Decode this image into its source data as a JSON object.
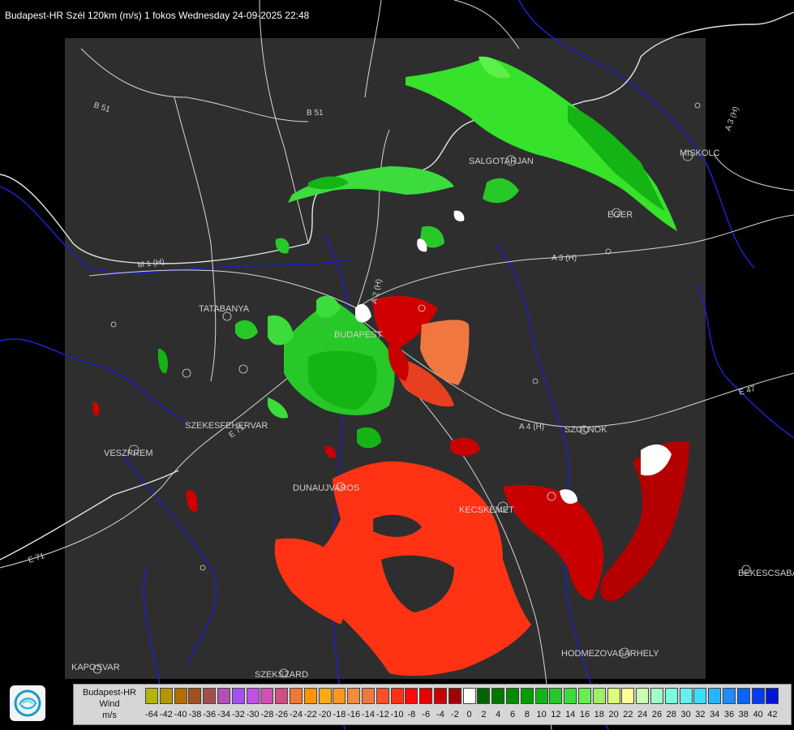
{
  "title": "Budapest-HR Szél 120km (m/s) 1 fokos Wednesday 24-09-2025 22:48",
  "map": {
    "cities": [
      {
        "name": "SALGOTARJAN"
      },
      {
        "name": "MISKOLC"
      },
      {
        "name": "EGER"
      },
      {
        "name": "TATABANYA"
      },
      {
        "name": "BUDAPEST"
      },
      {
        "name": "SZEKESFEHERVAR"
      },
      {
        "name": "VESZPREM"
      },
      {
        "name": "DUNAUJVAROS"
      },
      {
        "name": "KECSKEMET"
      },
      {
        "name": "SZOLNOK"
      },
      {
        "name": "BEKESCSABA"
      },
      {
        "name": "HODMEZOVASARHELY"
      },
      {
        "name": "KAPOSVAR"
      },
      {
        "name": "SZEKSZARD"
      }
    ],
    "roads": [
      "B 51",
      "B 51",
      "A 3 (H)",
      "A 3 (H)",
      "A 2 (H)",
      "M 1 (H)",
      "A 4 (H)",
      "E 71",
      "E 71",
      "E 47"
    ]
  },
  "legend": {
    "label_lines": [
      "Budapest-HR",
      "Wind",
      "m/s"
    ],
    "swatches": [
      {
        "value": "-64",
        "color": "#b4b40a"
      },
      {
        "value": "-42",
        "color": "#b49600"
      },
      {
        "value": "-40",
        "color": "#b46e00"
      },
      {
        "value": "-38",
        "color": "#a0501e"
      },
      {
        "value": "-36",
        "color": "#a05050"
      },
      {
        "value": "-34",
        "color": "#b450b4"
      },
      {
        "value": "-32",
        "color": "#a050f0"
      },
      {
        "value": "-30",
        "color": "#c050e6"
      },
      {
        "value": "-28",
        "color": "#d050b4"
      },
      {
        "value": "-26",
        "color": "#d24b82"
      },
      {
        "value": "-24",
        "color": "#f07832"
      },
      {
        "value": "-22",
        "color": "#ff9600"
      },
      {
        "value": "-20",
        "color": "#ffaa14"
      },
      {
        "value": "-18",
        "color": "#ff961e"
      },
      {
        "value": "-16",
        "color": "#f08c3c"
      },
      {
        "value": "-14",
        "color": "#f0783c"
      },
      {
        "value": "-12",
        "color": "#ff5028"
      },
      {
        "value": "-10",
        "color": "#ff3214"
      },
      {
        "value": "-8",
        "color": "#ff0a0a"
      },
      {
        "value": "-6",
        "color": "#e60000"
      },
      {
        "value": "-4",
        "color": "#c80000"
      },
      {
        "value": "-2",
        "color": "#a00000"
      },
      {
        "value": "0",
        "color": "#ffffff"
      },
      {
        "value": "2",
        "color": "#006400"
      },
      {
        "value": "4",
        "color": "#007800"
      },
      {
        "value": "6",
        "color": "#008c00"
      },
      {
        "value": "8",
        "color": "#00a000"
      },
      {
        "value": "10",
        "color": "#14b414"
      },
      {
        "value": "12",
        "color": "#28c828"
      },
      {
        "value": "14",
        "color": "#3cdc3c"
      },
      {
        "value": "16",
        "color": "#64f050"
      },
      {
        "value": "18",
        "color": "#a0f064"
      },
      {
        "value": "20",
        "color": "#dcff78"
      },
      {
        "value": "22",
        "color": "#ffff96"
      },
      {
        "value": "24",
        "color": "#c8ffb4"
      },
      {
        "value": "26",
        "color": "#a0ffc8"
      },
      {
        "value": "28",
        "color": "#78ffdc"
      },
      {
        "value": "30",
        "color": "#64f0f0"
      },
      {
        "value": "32",
        "color": "#3cdcff"
      },
      {
        "value": "34",
        "color": "#28b4ff"
      },
      {
        "value": "36",
        "color": "#1e8cff"
      },
      {
        "value": "38",
        "color": "#0a64ff"
      },
      {
        "value": "40",
        "color": "#003cf0"
      },
      {
        "value": "42",
        "color": "#0014dc"
      }
    ]
  },
  "colors": {
    "background": "#000000",
    "radar_area": "#2e2e2e",
    "rivers": "#1e1ec8",
    "borders": "#dcdcdc",
    "roads": "#dcdcdc"
  }
}
